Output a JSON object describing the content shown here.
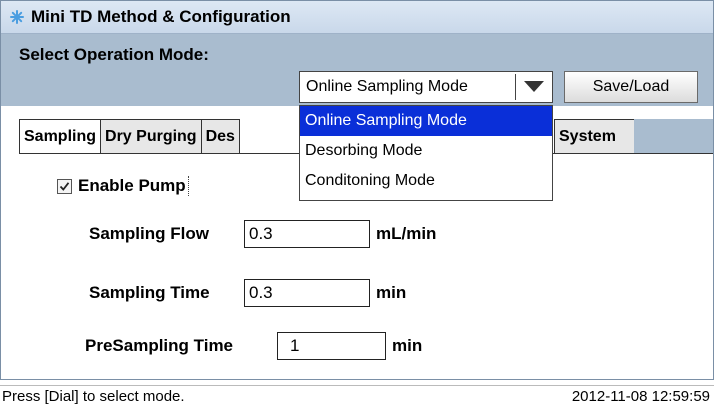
{
  "window": {
    "title": "Mini TD Method & Configuration",
    "icon": "asterisk-icon",
    "icon_color": "#4a9de0"
  },
  "mode_bar": {
    "label": "Select Operation Mode:",
    "selected_mode": "Online Sampling Mode",
    "save_button": "Save/Load"
  },
  "dropdown": {
    "options": [
      "Online Sampling Mode",
      "Desorbing Mode",
      "Conditoning Mode"
    ],
    "selected_index": 0,
    "highlight_color": "#0a2fd8"
  },
  "tabs": [
    {
      "label": "Sampling",
      "active": true
    },
    {
      "label": "Dry Purging",
      "active": false
    },
    {
      "label": "Des",
      "active": false
    },
    {
      "label": "System",
      "active": false
    }
  ],
  "sampling": {
    "enable_pump_label": "Enable Pump",
    "enable_pump_checked": true,
    "sampling_flow": {
      "label": "Sampling Flow",
      "value": "0.3",
      "unit": "mL/min"
    },
    "sampling_time": {
      "label": "Sampling Time",
      "value": "0.3",
      "unit": "min"
    },
    "presampling_time": {
      "label": "PreSampling Time",
      "value": "1",
      "unit": "min"
    }
  },
  "status_bar": {
    "message": "Press [Dial] to select mode.",
    "timestamp": "2012-11-08 12:59:59"
  }
}
